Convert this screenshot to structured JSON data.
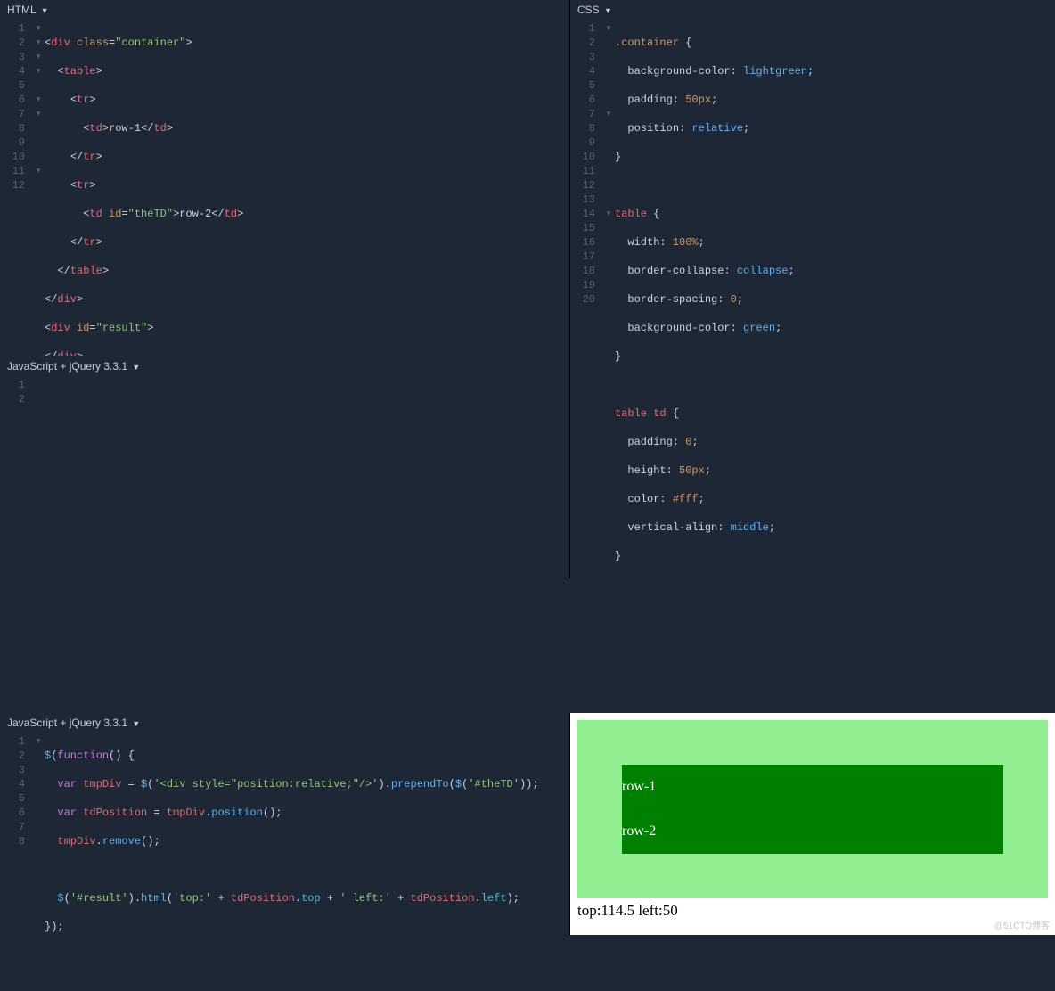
{
  "panes": {
    "html_label": "HTML",
    "css_label": "CSS",
    "js_label": "JavaScript + jQuery 3.3.1"
  },
  "html_lines": [
    "1",
    "2",
    "3",
    "4",
    "5",
    "6",
    "7",
    "8",
    "9",
    "10",
    "11",
    "12"
  ],
  "html_fold": [
    "▾",
    "▾",
    "▾",
    "▾",
    "",
    "▾",
    "▾",
    "",
    "",
    "",
    "▾",
    ""
  ],
  "html_code": {
    "t_div": "div",
    "t_table": "table",
    "t_tr": "tr",
    "t_td": "td",
    "a_class": "class",
    "a_id": "id",
    "v_container": "\"container\"",
    "v_theTD": "\"theTD\"",
    "v_result": "\"result\"",
    "txt_row1": "row-1",
    "txt_row2": "row-2"
  },
  "css_lines": [
    "1",
    "2",
    "3",
    "4",
    "5",
    "6",
    "7",
    "8",
    "9",
    "10",
    "11",
    "12",
    "13",
    "14",
    "15",
    "16",
    "17",
    "18",
    "19",
    "20"
  ],
  "css_fold": [
    "▾",
    "",
    "",
    "",
    "",
    "",
    "▾",
    "",
    "",
    "",
    "",
    "",
    "",
    "▾",
    "",
    "",
    "",
    "",
    "",
    ""
  ],
  "css_code": {
    "sel_container": ".container",
    "sel_table": "table",
    "sel_tabletd": "table td",
    "p_bg": "background-color",
    "v_lightgreen": "lightgreen",
    "v_green": "green",
    "p_padding": "padding",
    "v_50px": "50px",
    "v_0": "0",
    "p_position": "position",
    "v_relative": "relative",
    "p_width": "width",
    "v_100pct": "100%",
    "p_bc": "border-collapse",
    "v_collapse": "collapse",
    "p_bs": "border-spacing",
    "p_height": "height",
    "p_color": "color",
    "v_fff": "#fff",
    "p_va": "vertical-align",
    "v_middle": "middle"
  },
  "js_lines": [
    "1",
    "2",
    "3",
    "4",
    "5",
    "6",
    "7",
    "8"
  ],
  "js_fold": [
    "▾",
    "",
    "",
    "",
    "",
    "",
    "",
    ""
  ],
  "js_code": {
    "kw_var": "var",
    "fn_$": "$",
    "fn_function": "function",
    "id_tmpDiv": "tmpDiv",
    "id_tdPosition": "tdPosition",
    "str_div": "'<div style=\"position:relative;\"/>'",
    "str_theTD": "'#theTD'",
    "m_prependTo": "prependTo",
    "m_position": "position",
    "m_remove": "remove",
    "m_html": "html",
    "str_result": "'#result'",
    "str_top": "'top:'",
    "str_left": "' left:'",
    "dot_top": "top",
    "dot_left": "left"
  },
  "preview": {
    "row1": "row-1",
    "row2": "row-2",
    "result_text": "top:114.5 left:50"
  },
  "watermark": "@51CTO博客"
}
